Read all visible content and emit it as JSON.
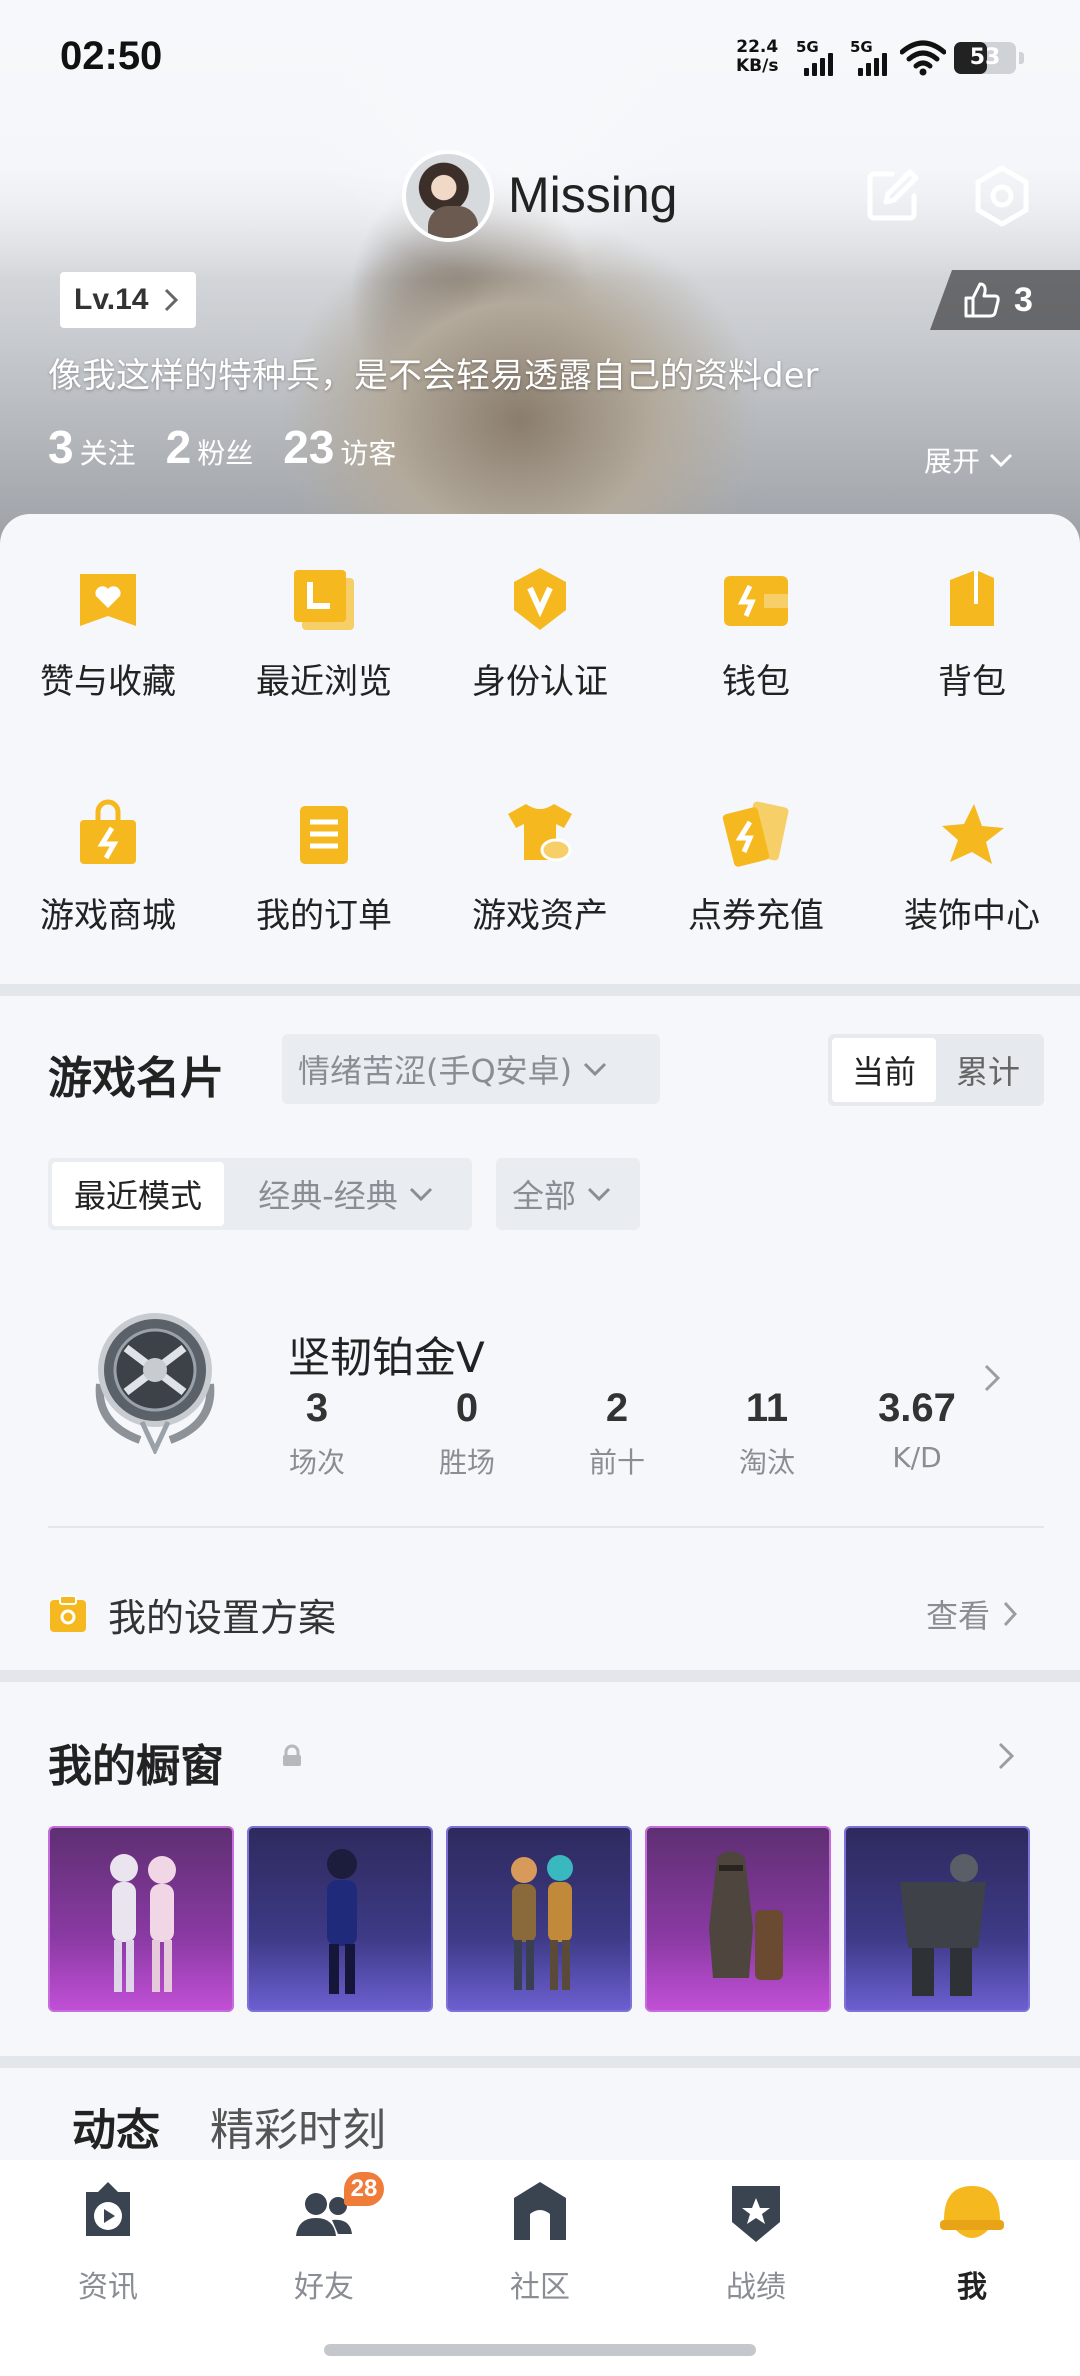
{
  "status_bar": {
    "time": "02:50",
    "net_speed_value": "22.4",
    "net_speed_unit": "KB/s",
    "sim1": "5G",
    "sim2": "5G",
    "battery": "53",
    "battery_level": 0.53
  },
  "profile": {
    "nickname": "Missing",
    "level": "Lv.14",
    "likes": "3",
    "bio": "像我这样的特种兵，是不会轻易透露自己的资料der",
    "stats": [
      {
        "value": "3",
        "label": "关注"
      },
      {
        "value": "2",
        "label": "粉丝"
      },
      {
        "value": "23",
        "label": "访客"
      }
    ],
    "expand": "展开"
  },
  "menu": [
    {
      "label": "赞与收藏",
      "icon": "heart-folder-icon"
    },
    {
      "label": "最近浏览",
      "icon": "history-icon"
    },
    {
      "label": "身份认证",
      "icon": "verified-badge-icon"
    },
    {
      "label": "钱包",
      "icon": "wallet-icon"
    },
    {
      "label": "背包",
      "icon": "backpack-icon"
    },
    {
      "label": "游戏商城",
      "icon": "shopping-bag-icon"
    },
    {
      "label": "我的订单",
      "icon": "order-clipboard-icon"
    },
    {
      "label": "游戏资产",
      "icon": "tshirt-coin-icon"
    },
    {
      "label": "点券充值",
      "icon": "voucher-cards-icon"
    },
    {
      "label": "装饰中心",
      "icon": "decoration-star-icon"
    }
  ],
  "game_card": {
    "title": "游戏名片",
    "account": "情绪苦涩(手Q安卓)",
    "scope_tabs": [
      "当前",
      "累计"
    ],
    "mode_current": "最近模式",
    "mode_select": "经典-经典",
    "filter": "全部",
    "rank_name": "坚韧铂金Ⅴ",
    "rank_stats": [
      {
        "value": "3",
        "label": "场次"
      },
      {
        "value": "0",
        "label": "胜场"
      },
      {
        "value": "2",
        "label": "前十"
      },
      {
        "value": "11",
        "label": "淘汰"
      },
      {
        "value": "3.67",
        "label": "K/D"
      }
    ],
    "setting_title": "我的设置方案",
    "setting_action": "查看"
  },
  "showcase": {
    "title": "我的橱窗",
    "items": [
      {
        "rarity": "purple"
      },
      {
        "rarity": "blue"
      },
      {
        "rarity": "blue"
      },
      {
        "rarity": "purple"
      },
      {
        "rarity": "blue"
      }
    ]
  },
  "feed_tabs": [
    "动态",
    "精彩时刻"
  ],
  "bottom_nav": [
    {
      "label": "资讯",
      "icon": "play-news-icon"
    },
    {
      "label": "好友",
      "icon": "friends-icon",
      "badge": "28"
    },
    {
      "label": "社区",
      "icon": "community-house-icon"
    },
    {
      "label": "战绩",
      "icon": "record-shield-icon"
    },
    {
      "label": "我",
      "icon": "helmet-icon",
      "active": true
    }
  ],
  "colors": {
    "accent_yellow": "#f5b81e",
    "badge_orange": "#f07c3a",
    "purple_rarity": "#a64ac0",
    "blue_rarity": "#5a50c0"
  }
}
